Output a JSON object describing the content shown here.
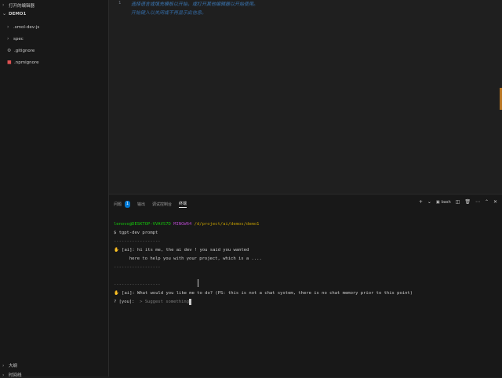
{
  "sidebar": {
    "open_editors_label": "打开的编辑器",
    "folder_name": "DEMO1",
    "items": [
      {
        "label": ".smol-dev-js",
        "icon": "chevron-right-icon"
      },
      {
        "label": "spec",
        "icon": "chevron-right-icon"
      },
      {
        "label": ".gitignore",
        "icon": "gear-icon"
      },
      {
        "label": ".npmignore",
        "icon": "npm-icon"
      }
    ],
    "outline_label": "大纲",
    "timeline_label": "时间线"
  },
  "editor": {
    "line_number": "1",
    "hint_line1": "选择语言或填充模板以开始，或打开其他编辑器以开始使用。",
    "hint_line2": "开始键入以关闭或不再显示此信息。"
  },
  "panel": {
    "tabs": [
      "问题",
      "输出",
      "调试控制台",
      "终端"
    ],
    "problems_count": "1",
    "shell_label": "bash"
  },
  "terminal": {
    "prompt_user": "lenovo@DESKTOP-VVAVS7D",
    "prompt_env": "MINGW64",
    "prompt_path": "/d/project/ai/demos/demo1",
    "command": "$ tgpt-dev prompt",
    "divider": "------------------",
    "ai_line1": "[ai]: hi its me, the ai dev ! you said you wanted",
    "ai_line2": "here to help you with your project, which is a ....",
    "ai_question": "[ai]: What would you like me to do? (PS: this is not a chat system, there is no chat memory prior to this point)",
    "you_prefix": "? [you]:",
    "you_placeholder": "> Suggest something"
  },
  "colors": {
    "accent": "#0078d4",
    "prompt_green": "#16c60c",
    "prompt_magenta": "#b148c6",
    "path_yellow": "#c19c00"
  }
}
